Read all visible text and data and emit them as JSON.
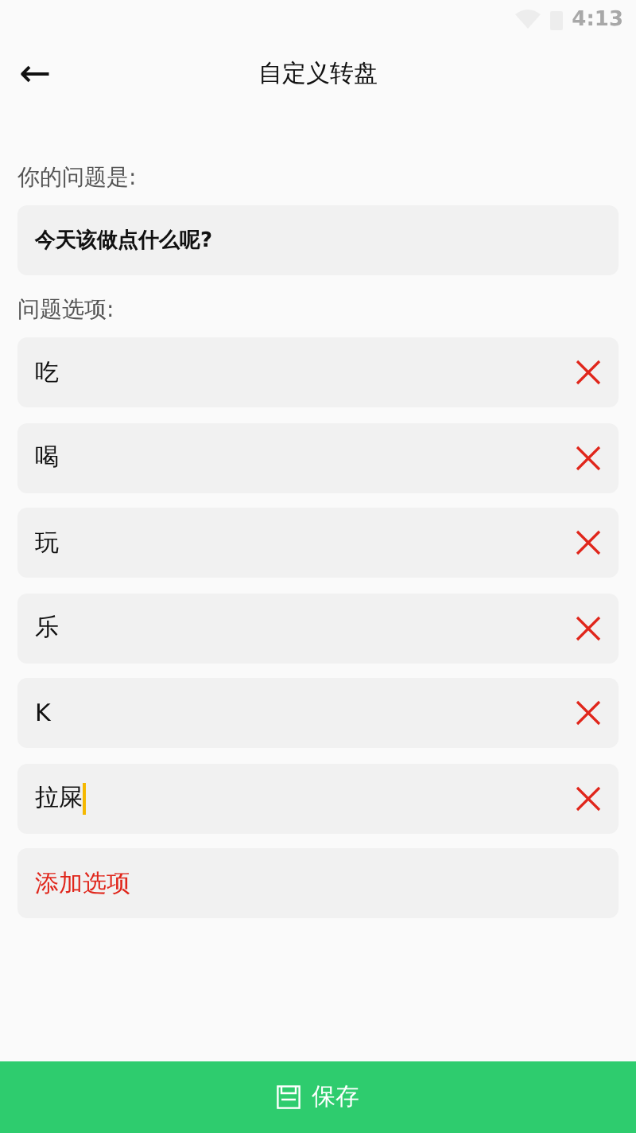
{
  "status_bar": {
    "time": "4:13"
  },
  "header": {
    "back": "←",
    "title": "自定义转盘"
  },
  "question": {
    "label": "你的问题是:",
    "value": "今天该做点什么呢?"
  },
  "options": {
    "label": "问题选项:",
    "items": [
      {
        "value": "吃",
        "focused": false
      },
      {
        "value": "喝",
        "focused": false
      },
      {
        "value": "玩",
        "focused": false
      },
      {
        "value": "乐",
        "focused": false
      },
      {
        "value": "K",
        "focused": false
      },
      {
        "value": "拉屎",
        "focused": true
      }
    ],
    "add": "添加选项"
  },
  "save": {
    "label": "保存"
  }
}
